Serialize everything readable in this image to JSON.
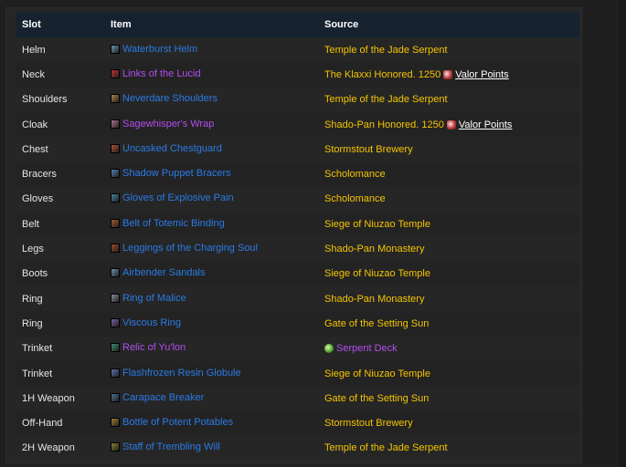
{
  "headers": {
    "slot": "Slot",
    "item": "Item",
    "source": "Source"
  },
  "rows": [
    {
      "slot": "Helm",
      "item": "Waterburst Helm",
      "quality": "rare",
      "icon": "helm-icon",
      "icon_color": "#6a8fb0",
      "source": "Temple of the Jade Serpent"
    },
    {
      "slot": "Neck",
      "item": "Links of the Lucid",
      "quality": "epic",
      "icon": "necklace-icon",
      "icon_color": "#c03030",
      "source_prefix": "The Klaxxi Honored. 1250",
      "source_link": "Valor Points"
    },
    {
      "slot": "Shoulders",
      "item": "Neverdare Shoulders",
      "quality": "rare",
      "icon": "shoulders-icon",
      "icon_color": "#b08040",
      "source": "Temple of the Jade Serpent"
    },
    {
      "slot": "Cloak",
      "item": "Sagewhisper's Wrap",
      "quality": "epic",
      "icon": "cloak-icon",
      "icon_color": "#b07090",
      "source_prefix": "Shado-Pan Honored. 1250",
      "source_link": "Valor Points"
    },
    {
      "slot": "Chest",
      "item": "Uncasked Chestguard",
      "quality": "rare",
      "icon": "chest-icon",
      "icon_color": "#b05030",
      "source": "Stormstout Brewery"
    },
    {
      "slot": "Bracers",
      "item": "Shadow Puppet Bracers",
      "quality": "rare",
      "icon": "bracers-icon",
      "icon_color": "#5080b0",
      "source": "Scholomance"
    },
    {
      "slot": "Gloves",
      "item": "Gloves of Explosive Pain",
      "quality": "rare",
      "icon": "gloves-icon",
      "icon_color": "#4a80a0",
      "source": "Scholomance"
    },
    {
      "slot": "Belt",
      "item": "Belt of Totemic Binding",
      "quality": "rare",
      "icon": "belt-icon",
      "icon_color": "#a05a30",
      "source": "Siege of Niuzao Temple"
    },
    {
      "slot": "Legs",
      "item": "Leggings of the Charging Soul",
      "quality": "rare",
      "icon": "legs-icon",
      "icon_color": "#a04a28",
      "source": "Shado-Pan Monastery"
    },
    {
      "slot": "Boots",
      "item": "Airbender Sandals",
      "quality": "rare",
      "icon": "boots-icon",
      "icon_color": "#6a90b0",
      "source": "Siege of Niuzao Temple"
    },
    {
      "slot": "Ring",
      "item": "Ring of Malice",
      "quality": "rare",
      "icon": "ring-icon",
      "icon_color": "#8a8a9a",
      "source": "Shado-Pan Monastery"
    },
    {
      "slot": "Ring",
      "item": "Viscous Ring",
      "quality": "rare",
      "icon": "ring-icon",
      "icon_color": "#7a5aa0",
      "source": "Gate of the Setting Sun"
    },
    {
      "slot": "Trinket",
      "item": "Relic of Yu'lon",
      "quality": "epic",
      "icon": "relic-icon",
      "icon_color": "#3a8a70",
      "source_deck": "Serpent Deck"
    },
    {
      "slot": "Trinket",
      "item": "Flashfrozen Resin Globule",
      "quality": "rare",
      "icon": "globule-icon",
      "icon_color": "#5a70b0",
      "source": "Siege of Niuzao Temple"
    },
    {
      "slot": "1H Weapon",
      "item": "Carapace Breaker",
      "quality": "rare",
      "icon": "mace-icon",
      "icon_color": "#4a7090",
      "source": "Gate of the Setting Sun"
    },
    {
      "slot": "Off-Hand",
      "item": "Bottle of Potent Potables",
      "quality": "rare",
      "icon": "bottle-icon",
      "icon_color": "#a07a30",
      "source": "Stormstout Brewery"
    },
    {
      "slot": "2H Weapon",
      "item": "Staff of Trembling Will",
      "quality": "rare",
      "icon": "staff-icon",
      "icon_color": "#8a7a30",
      "source": "Temple of the Jade Serpent"
    }
  ]
}
